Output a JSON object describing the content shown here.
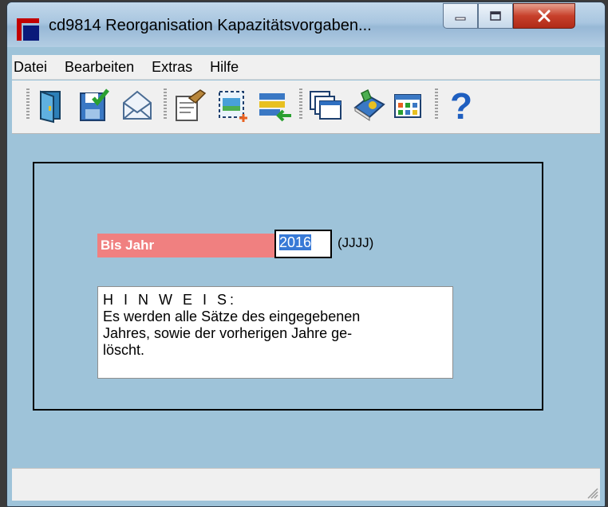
{
  "window": {
    "title": "cd9814 Reorganisation Kapazitätsvorgaben..."
  },
  "titlebar_buttons": [
    "minimize-icon",
    "maximize-icon",
    "close-icon"
  ],
  "menubar": {
    "items": [
      "Datei",
      "Bearbeiten",
      "Extras",
      "Hilfe"
    ]
  },
  "toolbar": {
    "tools": [
      "exit-door-icon",
      "save-icon",
      "mail-icon",
      "properties-icon",
      "new-select-icon",
      "list-transfer-icon",
      "windows-icon",
      "book-icon",
      "grid-icon",
      "help-icon"
    ]
  },
  "form": {
    "year_label": "Bis Jahr",
    "year_value": "2016",
    "year_format": "(JJJJ)",
    "hint_title": "H I N W E I S:",
    "hint_line1": "Es werden alle Sätze des eingegebenen",
    "hint_line2": "Jahres, sowie der vorherigen Jahre ge-",
    "hint_line3": "löscht."
  },
  "colors": {
    "label_bg": "#f08080",
    "client_bg": "#9ec3d9",
    "selection": "#3779d6"
  }
}
